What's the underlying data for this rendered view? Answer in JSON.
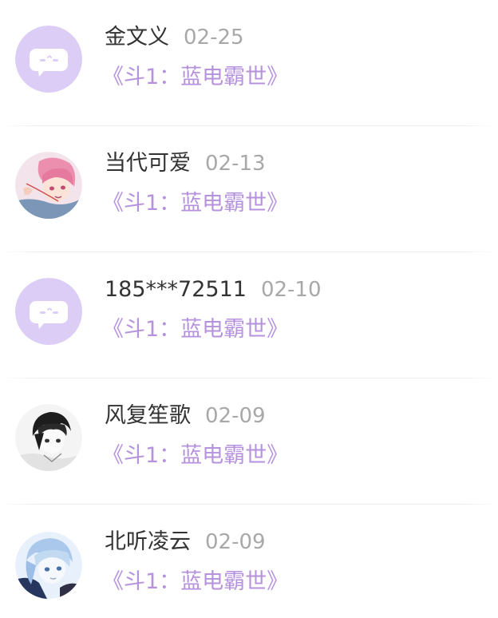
{
  "colors": {
    "accent": "#b692de",
    "default_avatar_bg": "#dccdf6",
    "name_text": "#333333",
    "date_text": "#a8a8a8"
  },
  "items": [
    {
      "name": "金文义",
      "date": "02-25",
      "work": "《斗1：蓝电霸世》",
      "avatar": "default-chat-avatar"
    },
    {
      "name": "当代可爱",
      "date": "02-13",
      "work": "《斗1：蓝电霸世》",
      "avatar": "anime-pink-hair-avatar"
    },
    {
      "name": "185***72511",
      "date": "02-10",
      "work": "《斗1：蓝电霸世》",
      "avatar": "default-chat-avatar"
    },
    {
      "name": "风复笙歌",
      "date": "02-09",
      "work": "《斗1：蓝电霸世》",
      "avatar": "anime-monochrome-avatar"
    },
    {
      "name": "北听凌云",
      "date": "02-09",
      "work": "《斗1：蓝电霸世》",
      "avatar": "anime-blue-hair-avatar"
    }
  ]
}
